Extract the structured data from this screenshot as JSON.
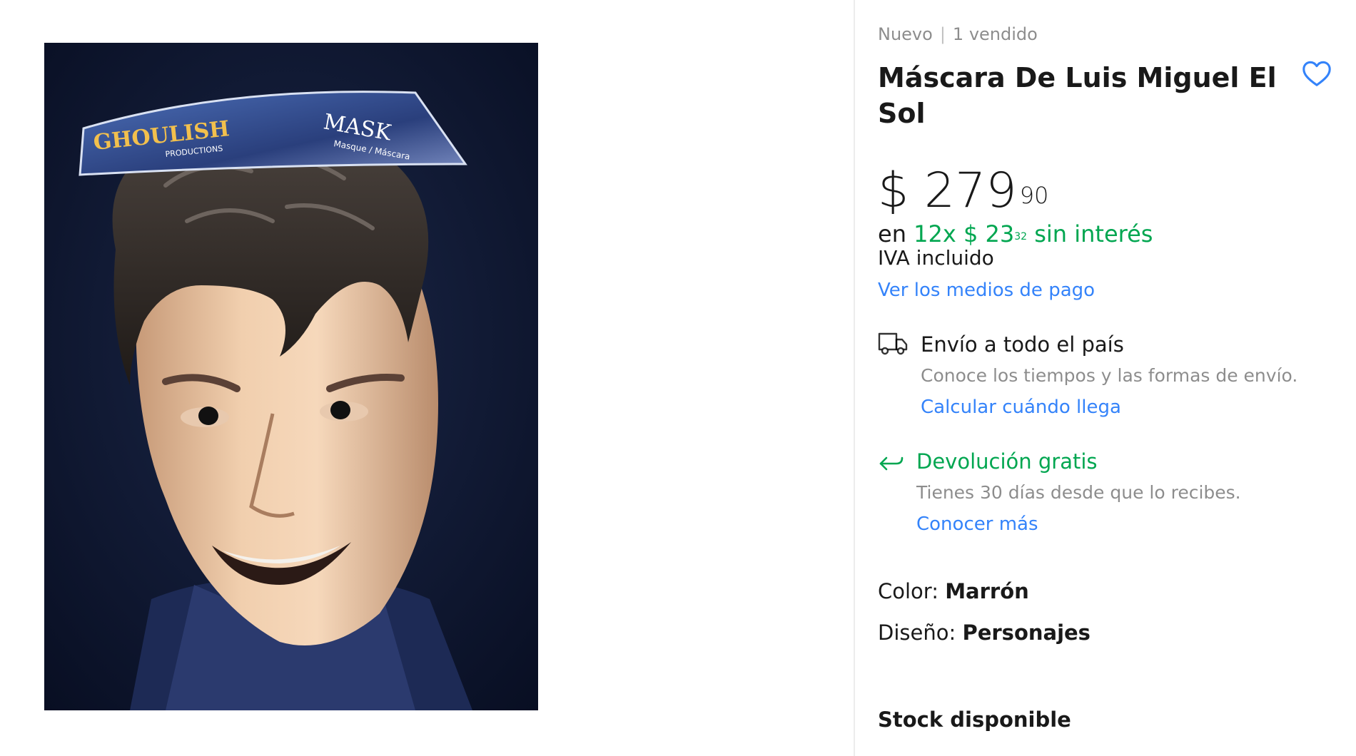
{
  "listing": {
    "condition": "Nuevo",
    "sold": "1 vendido",
    "title": "Máscara De Luis Miguel El Sol",
    "favorite_icon": "heart-outline-icon"
  },
  "price": {
    "currency": "$",
    "amount": "279",
    "cents": "90"
  },
  "installments": {
    "prefix": "en",
    "count": "12x",
    "currency": "$",
    "amount": "23",
    "cents": "32",
    "suffix": "sin interés"
  },
  "iva": "IVA incluido",
  "payment_link": "Ver los medios de pago",
  "shipping": {
    "icon": "truck-icon",
    "title": "Envío a todo el país",
    "subtitle": "Conoce los tiempos y las formas de envío.",
    "link": "Calcular cuándo llega"
  },
  "returns": {
    "icon": "return-arrow-icon",
    "title": "Devolución gratis",
    "subtitle": "Tienes 30 días desde que lo recibes.",
    "link": "Conocer más"
  },
  "specs": {
    "color_label": "Color: ",
    "color_value": "Marrón",
    "design_label": "Diseño: ",
    "design_value": "Personajes"
  },
  "stock": "Stock disponible",
  "image_label": {
    "brand": "GHOULISH",
    "brand_sub": "PRODUCTIONS",
    "mask": "MASK",
    "mask_sub": "Masque / Máscara"
  },
  "colors": {
    "accent_blue": "#3483fa",
    "accent_green": "#00a650",
    "image_bg": "#0e1630"
  }
}
